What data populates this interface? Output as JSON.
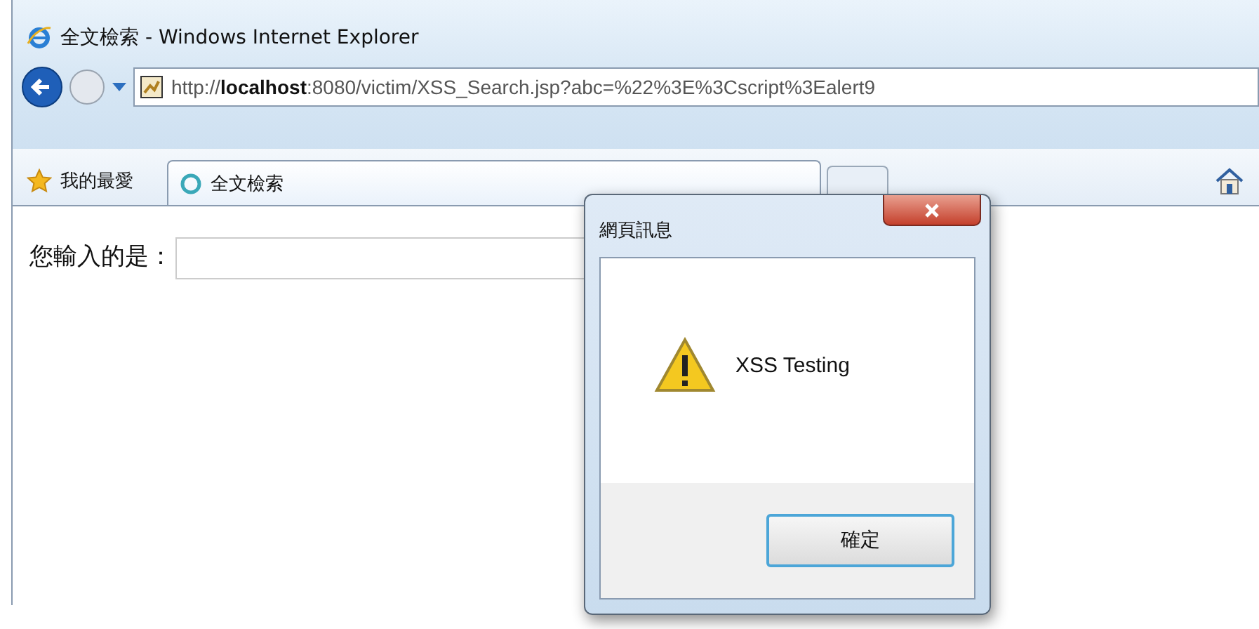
{
  "window": {
    "title": "全文檢索 - Windows Internet Explorer"
  },
  "address_bar": {
    "url": "http://**localhost**:8080/victim/XSS_Search.jsp?abc=%22%3E%3Cscript%3Ealert9"
  },
  "favorites": {
    "label": "我的最愛"
  },
  "tabs": [
    {
      "label": "全文檢索",
      "selected": true
    }
  ],
  "page": {
    "label": "您輸入的是："
  },
  "dialog": {
    "title": "網頁訊息",
    "message": "XSS Testing",
    "button": "確定"
  }
}
